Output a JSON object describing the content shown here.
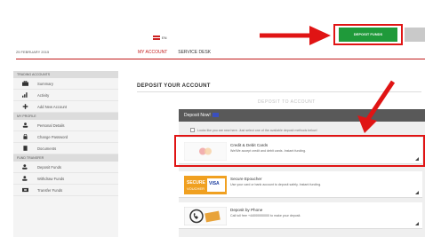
{
  "header": {
    "language": "EN",
    "deposit_button": "DEPOSIT FUNDS",
    "secondary_button": "",
    "date": "25 FEBRUARY 2015"
  },
  "nav": {
    "tabs": [
      {
        "label": "MY ACCOUNT",
        "active": true
      },
      {
        "label": "SERVICE DESK",
        "active": false
      }
    ]
  },
  "sidebar": {
    "sections": [
      {
        "title": "TRADING ACCOUNTS",
        "items": [
          {
            "label": "Summary",
            "icon": "briefcase-icon"
          },
          {
            "label": "Activity",
            "icon": "chart-icon"
          },
          {
            "label": "Add New Account",
            "icon": "plus-icon"
          }
        ]
      },
      {
        "title": "MY PROFILE",
        "items": [
          {
            "label": "Personal Details",
            "icon": "user-icon"
          },
          {
            "label": "Change Password",
            "icon": "lock-icon"
          },
          {
            "label": "Documents",
            "icon": "document-icon"
          }
        ]
      },
      {
        "title": "FUND TRANSFER",
        "items": [
          {
            "label": "Deposit Funds",
            "icon": "user-plus-icon"
          },
          {
            "label": "Withdraw Funds",
            "icon": "user-minus-icon"
          },
          {
            "label": "Transfer Funds",
            "icon": "transfer-icon"
          }
        ]
      }
    ]
  },
  "main": {
    "title": "DEPOSIT YOUR ACCOUNT",
    "subtitle": "DEPOSIT TO ACCOUNT",
    "panel_title": "Deposit Now!",
    "note": "Looks like you are new here. Just select one of the available deposit methods below!",
    "methods": [
      {
        "name": "Credit & Debit Cards",
        "desc": "We/We accept credit and debit cards. Instant funding.",
        "logo": "card-logo"
      },
      {
        "name": "Secure Epoucher",
        "desc": "Use your card or bank account to deposit safely. Instant funding.",
        "logo": "secure-voucher-logo",
        "logo_text": [
          "SECURE",
          "VISA",
          "VOUCHER"
        ]
      },
      {
        "name": "Deposit by Phone",
        "desc": "Call toll free +44000000000 to make your deposit.",
        "logo": "phone-logo"
      }
    ]
  },
  "colors": {
    "accent_red": "#c21a1a",
    "annotation_red": "#e01414",
    "deposit_green": "#1f9a3a",
    "panel_dark": "#595959"
  }
}
